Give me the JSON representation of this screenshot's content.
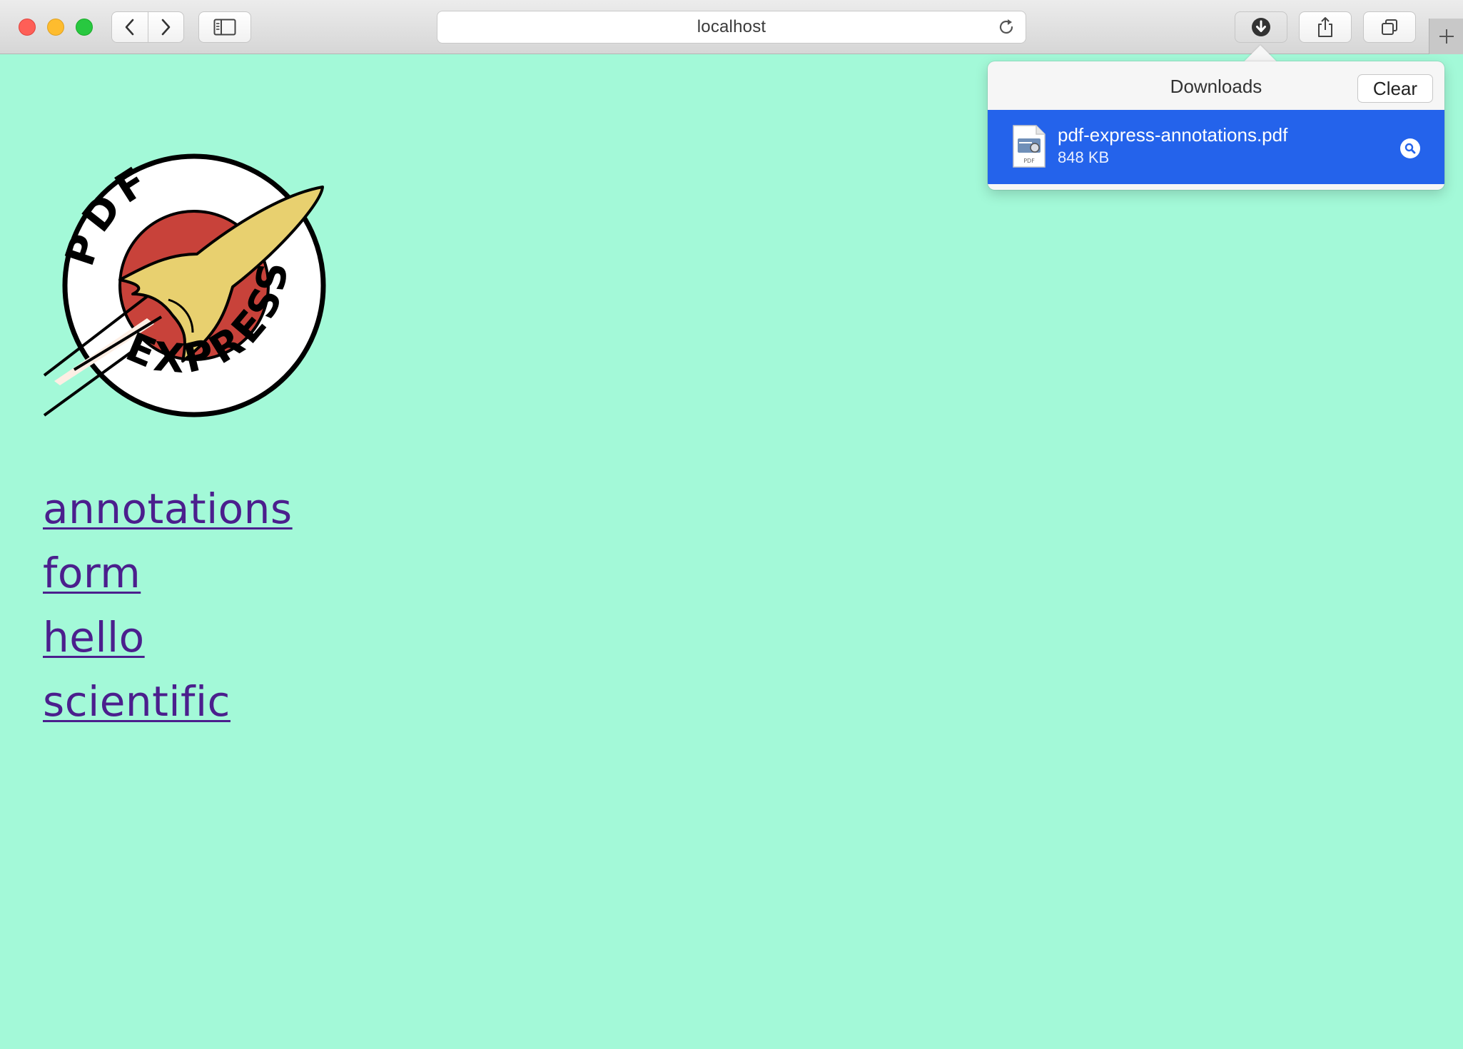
{
  "browser": {
    "url": "localhost",
    "toolbar_icons": [
      "back-icon",
      "forward-icon",
      "sidebar-icon",
      "reload-icon",
      "download-icon",
      "share-icon",
      "tabs-overview-icon",
      "plus-icon"
    ]
  },
  "page": {
    "logo": {
      "top_text": "PDF",
      "bottom_text": "EXPRESS"
    },
    "links": [
      "annotations",
      "form",
      "hello",
      "scientific"
    ]
  },
  "downloads": {
    "title": "Downloads",
    "clear_label": "Clear",
    "items": [
      {
        "name": "pdf-express-annotations.pdf",
        "size": "848 KB",
        "icon_label": "PDF"
      }
    ]
  },
  "colors": {
    "page_background": "#a3f9d8",
    "link": "#4b1f8d",
    "selection": "#2463eb"
  }
}
